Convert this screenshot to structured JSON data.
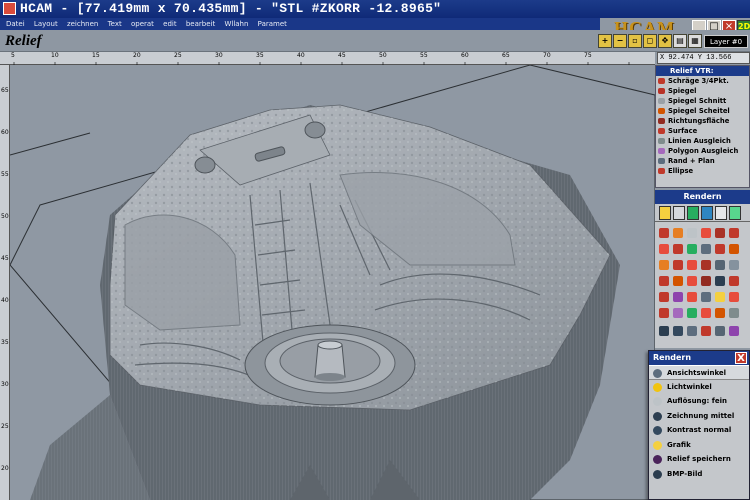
{
  "window": {
    "title": "HCAM - [77.419mm x 70.435mm] - \"STL #ZKORR -12.8965\"",
    "logo": "HCAM",
    "minimize": "_",
    "restore": "□",
    "close": "×"
  },
  "menu": [
    "Datei",
    "Layout",
    "zeichnen",
    "Text",
    "operat",
    "edit",
    "bearbeit",
    "Wllahn",
    "Paramet"
  ],
  "toolbar": {
    "mode_label": "Relief",
    "layer": "Layer #0",
    "zoom_label": "2D"
  },
  "coordinates": "X 92.474 Y 13.566",
  "ruler_top_ticks": [
    "5",
    "10",
    "15",
    "20",
    "25",
    "30",
    "35",
    "40",
    "45",
    "50",
    "55",
    "60",
    "65",
    "70",
    "75"
  ],
  "ruler_left_ticks": [
    "65",
    "60",
    "55",
    "50",
    "45",
    "40",
    "35",
    "30",
    "25",
    "20"
  ],
  "relief_panel": {
    "title": "Relief VTR:",
    "items": [
      {
        "label": "Schräge 3/4Pkt.",
        "icon": "slope-icon",
        "color": "#c0392b"
      },
      {
        "label": "Spiegel",
        "icon": "mirror-icon",
        "color": "#b83227"
      },
      {
        "label": "Spiegel Schnitt",
        "icon": "mirror-cut-icon",
        "color": "#9aa0a6"
      },
      {
        "label": "Spiegel Scheitel",
        "icon": "mirror-apex-icon",
        "color": "#d35400"
      },
      {
        "label": "Richtungsfläche",
        "icon": "direction-surface-icon",
        "color": "#922b21"
      },
      {
        "label": "Surface",
        "icon": "surface-icon",
        "color": "#c0392b"
      },
      {
        "label": "Linien Ausgleich",
        "icon": "line-balance-icon",
        "color": "#7f8c8d"
      },
      {
        "label": "Polygon Ausgleich",
        "icon": "polygon-balance-icon",
        "color": "#a569bd"
      },
      {
        "label": "Rand + Plan",
        "icon": "edge-plane-icon",
        "color": "#5d6d7e"
      },
      {
        "label": "Ellipse",
        "icon": "ellipse-icon",
        "color": "#c0392b"
      }
    ]
  },
  "render_panel": {
    "title": "Rendern"
  },
  "render_popup": {
    "title": "Rendern",
    "close": "X",
    "items": [
      {
        "label": "Ansichtswinkel",
        "icon": "view-angle-icon",
        "color": "#5d6d7e"
      },
      {
        "label": "Lichtwinkel",
        "icon": "light-angle-icon",
        "color": "#f1c40f"
      },
      {
        "label": "Auflösung: fein",
        "icon": "resolution-icon",
        "color": "#bdc3c7"
      },
      {
        "label": "Zeichnung mittel",
        "icon": "drawing-icon",
        "color": "#2c3e50"
      },
      {
        "label": "Kontrast normal",
        "icon": "contrast-icon",
        "color": "#34495e"
      },
      {
        "label": "Grafik",
        "icon": "graphic-icon",
        "color": "#f4d03f"
      },
      {
        "label": "Relief speichern",
        "icon": "save-relief-icon",
        "color": "#4a235a"
      },
      {
        "label": "BMP-Bild",
        "icon": "bmp-icon",
        "color": "#2c3e50"
      }
    ]
  },
  "colors": {
    "title_bar": "#1c3b8a",
    "background": "#8f98a3",
    "relief": "#9ea4ab",
    "logo": "#c8921b"
  }
}
